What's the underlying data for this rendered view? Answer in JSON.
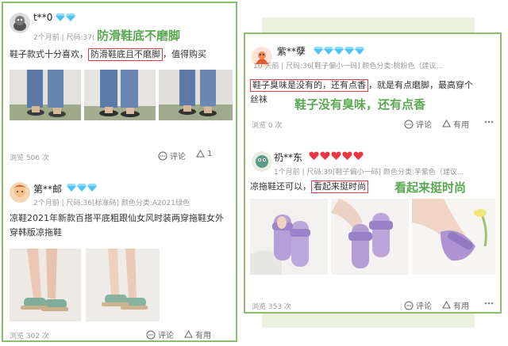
{
  "left_panel": {
    "reviews": [
      {
        "username": "t**0",
        "diamonds": 2,
        "meta": "2个月前 | 尺码:37(",
        "callout": "防滑鞋底不磨脚",
        "text_before": "鞋子款式十分喜欢，",
        "text_highlight": "防滑鞋底且不磨脚",
        "text_after": "，值得购买",
        "views": "浏览 506 次",
        "comment_label": "评论",
        "like_count": "1"
      },
      {
        "username": "第**邮",
        "diamonds": 3,
        "meta": "2个月前 | 尺码:36[标准码] 颜色分类:A2021绿色",
        "text_line1": "凉鞋2021年新款百搭平底粗跟仙女风时装两穿拖鞋女外",
        "text_line2": "穿韩版凉拖鞋",
        "views": "浏览 302 次",
        "comment_label": "评论",
        "useful_label": "有用"
      }
    ]
  },
  "right_panel": {
    "reviews": [
      {
        "username": "紫**孽",
        "diamonds": 5,
        "meta": "10 天前 | 尺码:36[鞋子偏小一码] 颜色分类:桃粉色（建议...",
        "text_highlight": "鞋子臭味是没有的，还有点香",
        "text_after": "，就是有点磨脚，最高穿个",
        "text_line2": "丝袜",
        "callout": "鞋子没有臭味，还有点香",
        "views": "浏览 0 次",
        "comment_label": "评论",
        "useful_label": "有用"
      },
      {
        "username": "礽**东",
        "hearts": 5,
        "meta": "1个月前 | 尺码:39[鞋子偏小一码] 颜色分类:芋紫色（建议...",
        "text_before": "凉拖鞋还可以，",
        "text_highlight": "看起来挺时尚",
        "callout": "看起来挺时尚",
        "views": "浏览 353 次",
        "comment_label": "评论",
        "useful_label": "有用"
      }
    ]
  },
  "colors": {
    "panel_border": "#8cbf6c",
    "callout": "#5aa852",
    "highlight_box": "#e03c3c",
    "diamond": "#4fc3f7",
    "heart": "#e9383f",
    "meta": "#9a9a9a"
  },
  "icons": [
    "diamond-badge-icon",
    "heart-badge-icon",
    "comment-icon",
    "like-icon",
    "useful-icon",
    "more-icon"
  ]
}
